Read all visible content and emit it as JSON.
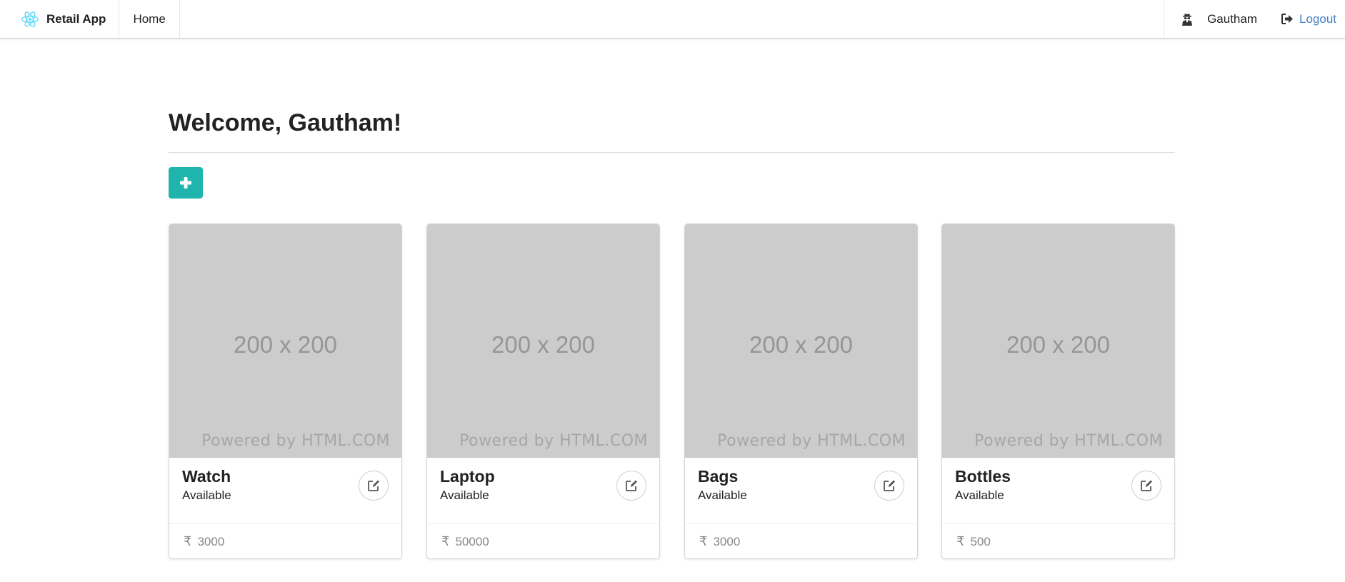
{
  "navbar": {
    "brand": "Retail App",
    "home": "Home",
    "user": "Gautham",
    "logout": "Logout",
    "brand_icon": "react-logo-icon",
    "user_icon": "user-secret-icon",
    "logout_icon": "sign-out-icon",
    "link_color": "#4183c4"
  },
  "main": {
    "title": "Welcome, Gautham!",
    "add_icon": "plus-icon",
    "accent": "#1fb5ac"
  },
  "products": [
    {
      "name": "Watch",
      "status": "Available",
      "currency": "₹",
      "price": "3000",
      "image_text": "200 x 200",
      "image_caption": "Powered by HTML.COM"
    },
    {
      "name": "Laptop",
      "status": "Available",
      "currency": "₹",
      "price": "50000",
      "image_text": "200 x 200",
      "image_caption": "Powered by HTML.COM"
    },
    {
      "name": "Bags",
      "status": "Available",
      "currency": "₹",
      "price": "3000",
      "image_text": "200 x 200",
      "image_caption": "Powered by HTML.COM"
    },
    {
      "name": "Bottles",
      "status": "Available",
      "currency": "₹",
      "price": "500",
      "image_text": "200 x 200",
      "image_caption": "Powered by HTML.COM"
    }
  ]
}
